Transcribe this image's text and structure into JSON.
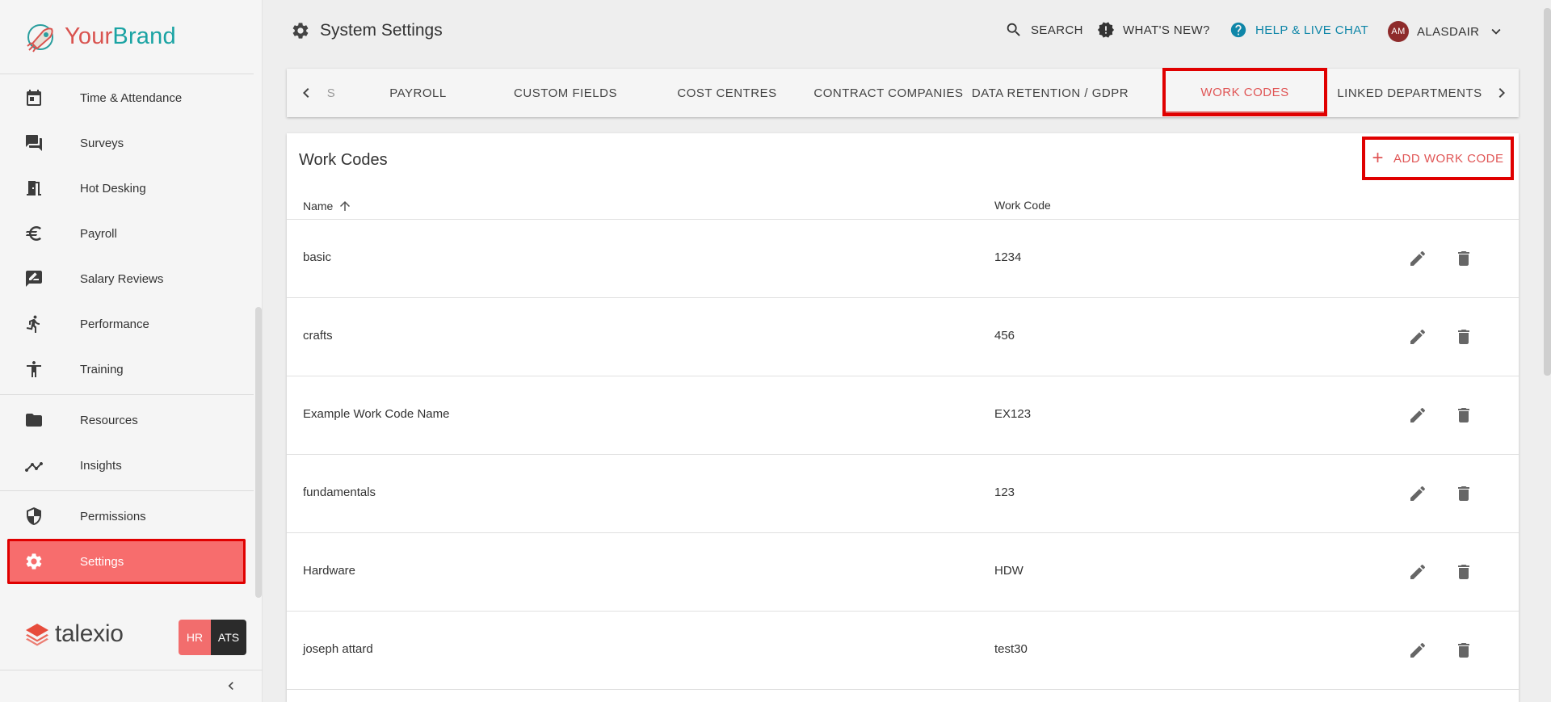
{
  "brand": {
    "your": "Your",
    "brand": "Brand"
  },
  "sidebar": {
    "items": [
      {
        "label": "Time & Attendance",
        "icon": "calendar-icon"
      },
      {
        "label": "Surveys",
        "icon": "forum-icon"
      },
      {
        "label": "Hot Desking",
        "icon": "door-icon"
      },
      {
        "label": "Payroll",
        "icon": "euro-icon"
      },
      {
        "label": "Salary Reviews",
        "icon": "rate-review-icon"
      },
      {
        "label": "Performance",
        "icon": "run-icon"
      },
      {
        "label": "Training",
        "icon": "accessibility-icon"
      },
      {
        "label": "Resources",
        "icon": "folder-icon"
      },
      {
        "label": "Insights",
        "icon": "insights-icon"
      },
      {
        "label": "Permissions",
        "icon": "shield-icon"
      },
      {
        "label": "Settings",
        "icon": "gear-icon",
        "active": true
      }
    ],
    "footer_logo": "talexio",
    "hr_label": "HR",
    "ats_label": "ATS"
  },
  "header": {
    "title": "System Settings",
    "search_label": "SEARCH",
    "news_label": "WHAT'S NEW?",
    "help_label": "HELP & LIVE CHAT",
    "user_initials": "AM",
    "user_name": "ALASDAIR"
  },
  "tabs": {
    "partial": "S",
    "items": [
      "PAYROLL",
      "CUSTOM FIELDS",
      "COST CENTRES",
      "CONTRACT COMPANIES",
      "DATA RETENTION / GDPR",
      "WORK CODES",
      "LINKED DEPARTMENTS"
    ],
    "active": "WORK CODES"
  },
  "card": {
    "title": "Work Codes",
    "add_label": "ADD WORK CODE",
    "col_name": "Name",
    "col_code": "Work Code",
    "rows": [
      {
        "name": "basic",
        "code": "1234"
      },
      {
        "name": "crafts",
        "code": "456"
      },
      {
        "name": "Example Work Code Name",
        "code": "EX123"
      },
      {
        "name": "fundamentals",
        "code": "123"
      },
      {
        "name": "Hardware",
        "code": "HDW"
      },
      {
        "name": "joseph attard",
        "code": "test30"
      }
    ]
  },
  "colors": {
    "accent": "#e05555",
    "highlight": "#e00000",
    "active_bg": "#f76d6d",
    "help": "#0f86a8"
  }
}
